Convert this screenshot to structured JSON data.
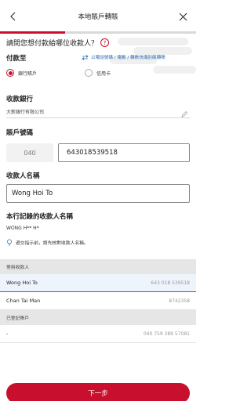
{
  "header": {
    "title": "本地賬戶轉賬",
    "back_icon": "back-arrow-icon",
    "close_icon": "close-icon"
  },
  "progress": {
    "fraction": 0.33,
    "color": "#c8102e"
  },
  "question": {
    "text": "請問您想付款給哪位收款人？"
  },
  "pay_to": {
    "label": "付款至",
    "switch_link": "以電話號碼 / 電郵 / 轉數快識別碼轉賬",
    "options": [
      {
        "label": "銀行賬戶",
        "selected": true
      },
      {
        "label": "信用卡",
        "selected": false
      }
    ]
  },
  "bank": {
    "label": "收款銀行",
    "value": "大新銀行有限公司"
  },
  "account": {
    "label": "賬戶號碼",
    "bank_code": "040",
    "number": "643018539518"
  },
  "payee": {
    "label": "收款人名稱",
    "value": "Wong Hoi To"
  },
  "record": {
    "label": "本行記錄的收款人名稱",
    "name": "WONG H** H*",
    "tip": "遞交指示前，請先核對收款人名稱。"
  },
  "payee_list": {
    "frequent_header": "常用收款人",
    "frequent": [
      {
        "name": "Wong Hoi To",
        "account": "643 018 539518",
        "selected": true
      },
      {
        "name": "Chan Tai Man",
        "account": "8742358",
        "selected": false
      }
    ],
    "registered_header": "已登記賬戶",
    "registered": [
      {
        "name": "-",
        "account": "040 759 389 57081",
        "selected": false
      }
    ]
  },
  "next_button": {
    "label": "下一步"
  },
  "colors": {
    "accent": "#c8102e",
    "link": "#2b6cb0"
  }
}
